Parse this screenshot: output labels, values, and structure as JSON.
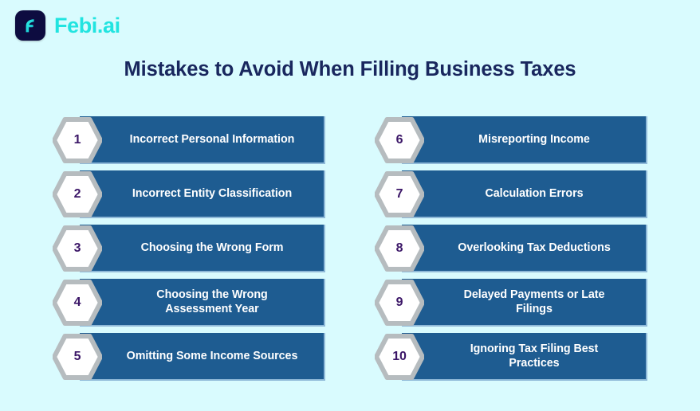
{
  "brand": {
    "name": "Febi.ai",
    "mark_icon": "febi-f-logomark",
    "mark_bg": "#0d0c40",
    "mark_fg": "#21e4e0",
    "name_color": "#21e4e0"
  },
  "header": {
    "title": "Mistakes to Avoid When Filling Business Taxes",
    "title_color": "#19275e"
  },
  "theme": {
    "background": "#d9fbfe",
    "bar_fill": "#1e5c91",
    "bar_edge": "#8fb9d8",
    "hex_fill": "#ffffff",
    "hex_stroke": "#b6bcbf",
    "number_color": "#3b1667",
    "label_color": "#ffffff"
  },
  "columns": [
    {
      "name": "left-column",
      "items": [
        {
          "number": "1",
          "label": "Incorrect Personal Information"
        },
        {
          "number": "2",
          "label": "Incorrect Entity Classification"
        },
        {
          "number": "3",
          "label": "Choosing the Wrong Form"
        },
        {
          "number": "4",
          "label": "Choosing the Wrong\nAssessment  Year"
        },
        {
          "number": "5",
          "label": "Omitting Some Income Sources"
        }
      ]
    },
    {
      "name": "right-column",
      "items": [
        {
          "number": "6",
          "label": "Misreporting Income"
        },
        {
          "number": "7",
          "label": "Calculation Errors"
        },
        {
          "number": "8",
          "label": "Overlooking Tax Deductions"
        },
        {
          "number": "9",
          "label": "Delayed Payments or Late\nFilings"
        },
        {
          "number": "10",
          "label": "Ignoring Tax Filing Best\nPractices"
        }
      ]
    }
  ]
}
